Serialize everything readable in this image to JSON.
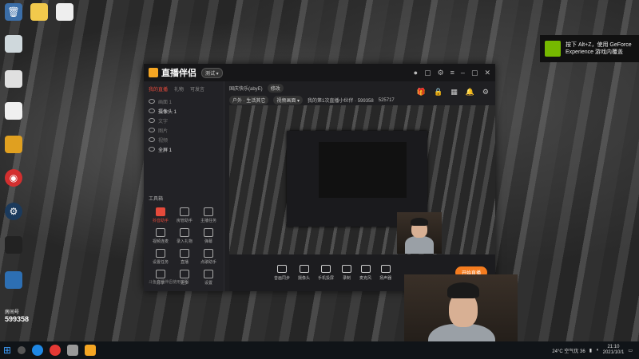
{
  "desktop": {
    "icons": [
      {
        "name": "recycle-bin-icon",
        "label": ""
      },
      {
        "name": "note-icon",
        "label": ""
      },
      {
        "name": "file-icon",
        "label": ""
      },
      {
        "name": "folder-icon",
        "label": ""
      },
      {
        "name": "doc-icon",
        "label": ""
      },
      {
        "name": "game-icon",
        "label": ""
      },
      {
        "name": "netease-icon",
        "label": ""
      },
      {
        "name": "steam-icon",
        "label": ""
      },
      {
        "name": "app-icon",
        "label": ""
      },
      {
        "name": "tool-icon",
        "label": ""
      }
    ]
  },
  "app": {
    "title": "直播伴侣",
    "badge": "测试 ▾",
    "left_tabs": [
      "我的直播",
      "礼物",
      "可发言"
    ],
    "sources": [
      {
        "label": "画面 1",
        "on": false
      },
      {
        "label": "摄像头 1",
        "on": true
      },
      {
        "label": "文字",
        "on": false
      },
      {
        "label": "图片",
        "on": false
      },
      {
        "label": "视频",
        "on": false
      },
      {
        "label": "全屏 1",
        "on": true
      }
    ],
    "tools_header": "工具箱",
    "tools": [
      {
        "label": "抖音助手",
        "red": true
      },
      {
        "label": "房管助手",
        "red": false
      },
      {
        "label": "主播任务",
        "red": false
      },
      {
        "label": "视频连麦",
        "red": false
      },
      {
        "label": "录入礼物",
        "red": false
      },
      {
        "label": "弹幕",
        "red": false
      },
      {
        "label": "设置任务",
        "red": false
      },
      {
        "label": "直播",
        "red": false
      },
      {
        "label": "点歌助手",
        "red": false
      },
      {
        "label": "分享",
        "red": false
      },
      {
        "label": "更多",
        "red": false
      },
      {
        "label": "设置",
        "red": false
      }
    ],
    "hint": "斗鱼直播伴侣使用说明",
    "stream_title": "国庆快乐(abyE)",
    "stream_tag": "修改",
    "meta_chips": [
      "户外 · 生活其它",
      "视频画面 ▾"
    ],
    "meta_text": "我的第1次直播小伙伴 · 599358",
    "viewers": "525717",
    "bottom_tools": [
      "音画同步",
      "摄像头",
      "手机投屏",
      "录制",
      "麦克风",
      "扬声器"
    ],
    "live_button": "开始直播"
  },
  "nvidia": {
    "line1": "按下 Alt+Z，使用 GeForce",
    "line2": "Experience 游戏内覆盖"
  },
  "room": {
    "label": "房间号",
    "number": "599358"
  },
  "tray": {
    "weather": "24°C  空气优 36",
    "time": "21:10",
    "date": "2021/10/1"
  }
}
